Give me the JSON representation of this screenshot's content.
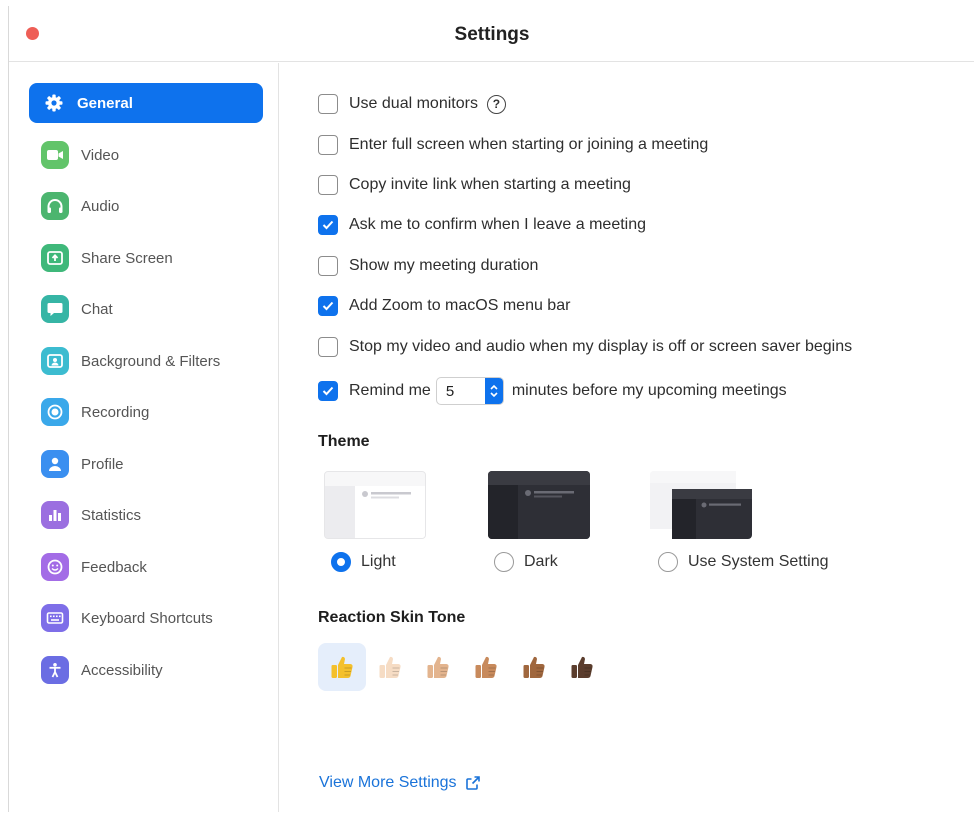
{
  "window": {
    "title": "Settings"
  },
  "sidebar": {
    "items": [
      {
        "label": "General",
        "icon": "gear-icon",
        "color": "#0e72ed",
        "active": true
      },
      {
        "label": "Video",
        "icon": "video-camera-icon",
        "color": "#62c46a"
      },
      {
        "label": "Audio",
        "icon": "headphones-icon",
        "color": "#4cb56f"
      },
      {
        "label": "Share Screen",
        "icon": "share-screen-icon",
        "color": "#3fb87a"
      },
      {
        "label": "Chat",
        "icon": "chat-bubble-icon",
        "color": "#36b5a5"
      },
      {
        "label": "Background & Filters",
        "icon": "portrait-icon",
        "color": "#3cbcd0"
      },
      {
        "label": "Recording",
        "icon": "record-icon",
        "color": "#3aa8ea"
      },
      {
        "label": "Profile",
        "icon": "person-icon",
        "color": "#3a8ff0"
      },
      {
        "label": "Statistics",
        "icon": "bar-chart-icon",
        "color": "#9b6fe0"
      },
      {
        "label": "Feedback",
        "icon": "smiley-icon",
        "color": "#a36ce6"
      },
      {
        "label": "Keyboard Shortcuts",
        "icon": "keyboard-icon",
        "color": "#7e6ee8"
      },
      {
        "label": "Accessibility",
        "icon": "accessibility-icon",
        "color": "#6b6de3"
      }
    ]
  },
  "general": {
    "options": [
      {
        "label": "Use dual monitors",
        "checked": false,
        "help": "?"
      },
      {
        "label": "Enter full screen when starting or joining a meeting",
        "checked": false
      },
      {
        "label": "Copy invite link when starting a meeting",
        "checked": false
      },
      {
        "label": "Ask me to confirm when I leave a meeting",
        "checked": true
      },
      {
        "label": "Show my meeting duration",
        "checked": false
      },
      {
        "label": "Add Zoom to macOS menu bar",
        "checked": true
      },
      {
        "label": "Stop my video and audio when my display is off or screen saver begins",
        "checked": false
      }
    ],
    "remind": {
      "checked": true,
      "prefix": "Remind me",
      "minutes": "5",
      "suffix": "minutes before my upcoming meetings"
    },
    "theme": {
      "title": "Theme",
      "options": [
        {
          "label": "Light",
          "selected": true
        },
        {
          "label": "Dark",
          "selected": false
        },
        {
          "label": "Use System Setting",
          "selected": false
        }
      ]
    },
    "skin_tone": {
      "title": "Reaction Skin Tone",
      "selected_index": 0,
      "tones": [
        "#f4c02c",
        "#f6dcc4",
        "#e3b48e",
        "#c88a5c",
        "#a0673e",
        "#5b3d2d"
      ]
    },
    "more_link": "View More Settings"
  },
  "colors": {
    "accent": "#0e72ed",
    "link": "#1a73d9",
    "close": "#ee5e56"
  }
}
